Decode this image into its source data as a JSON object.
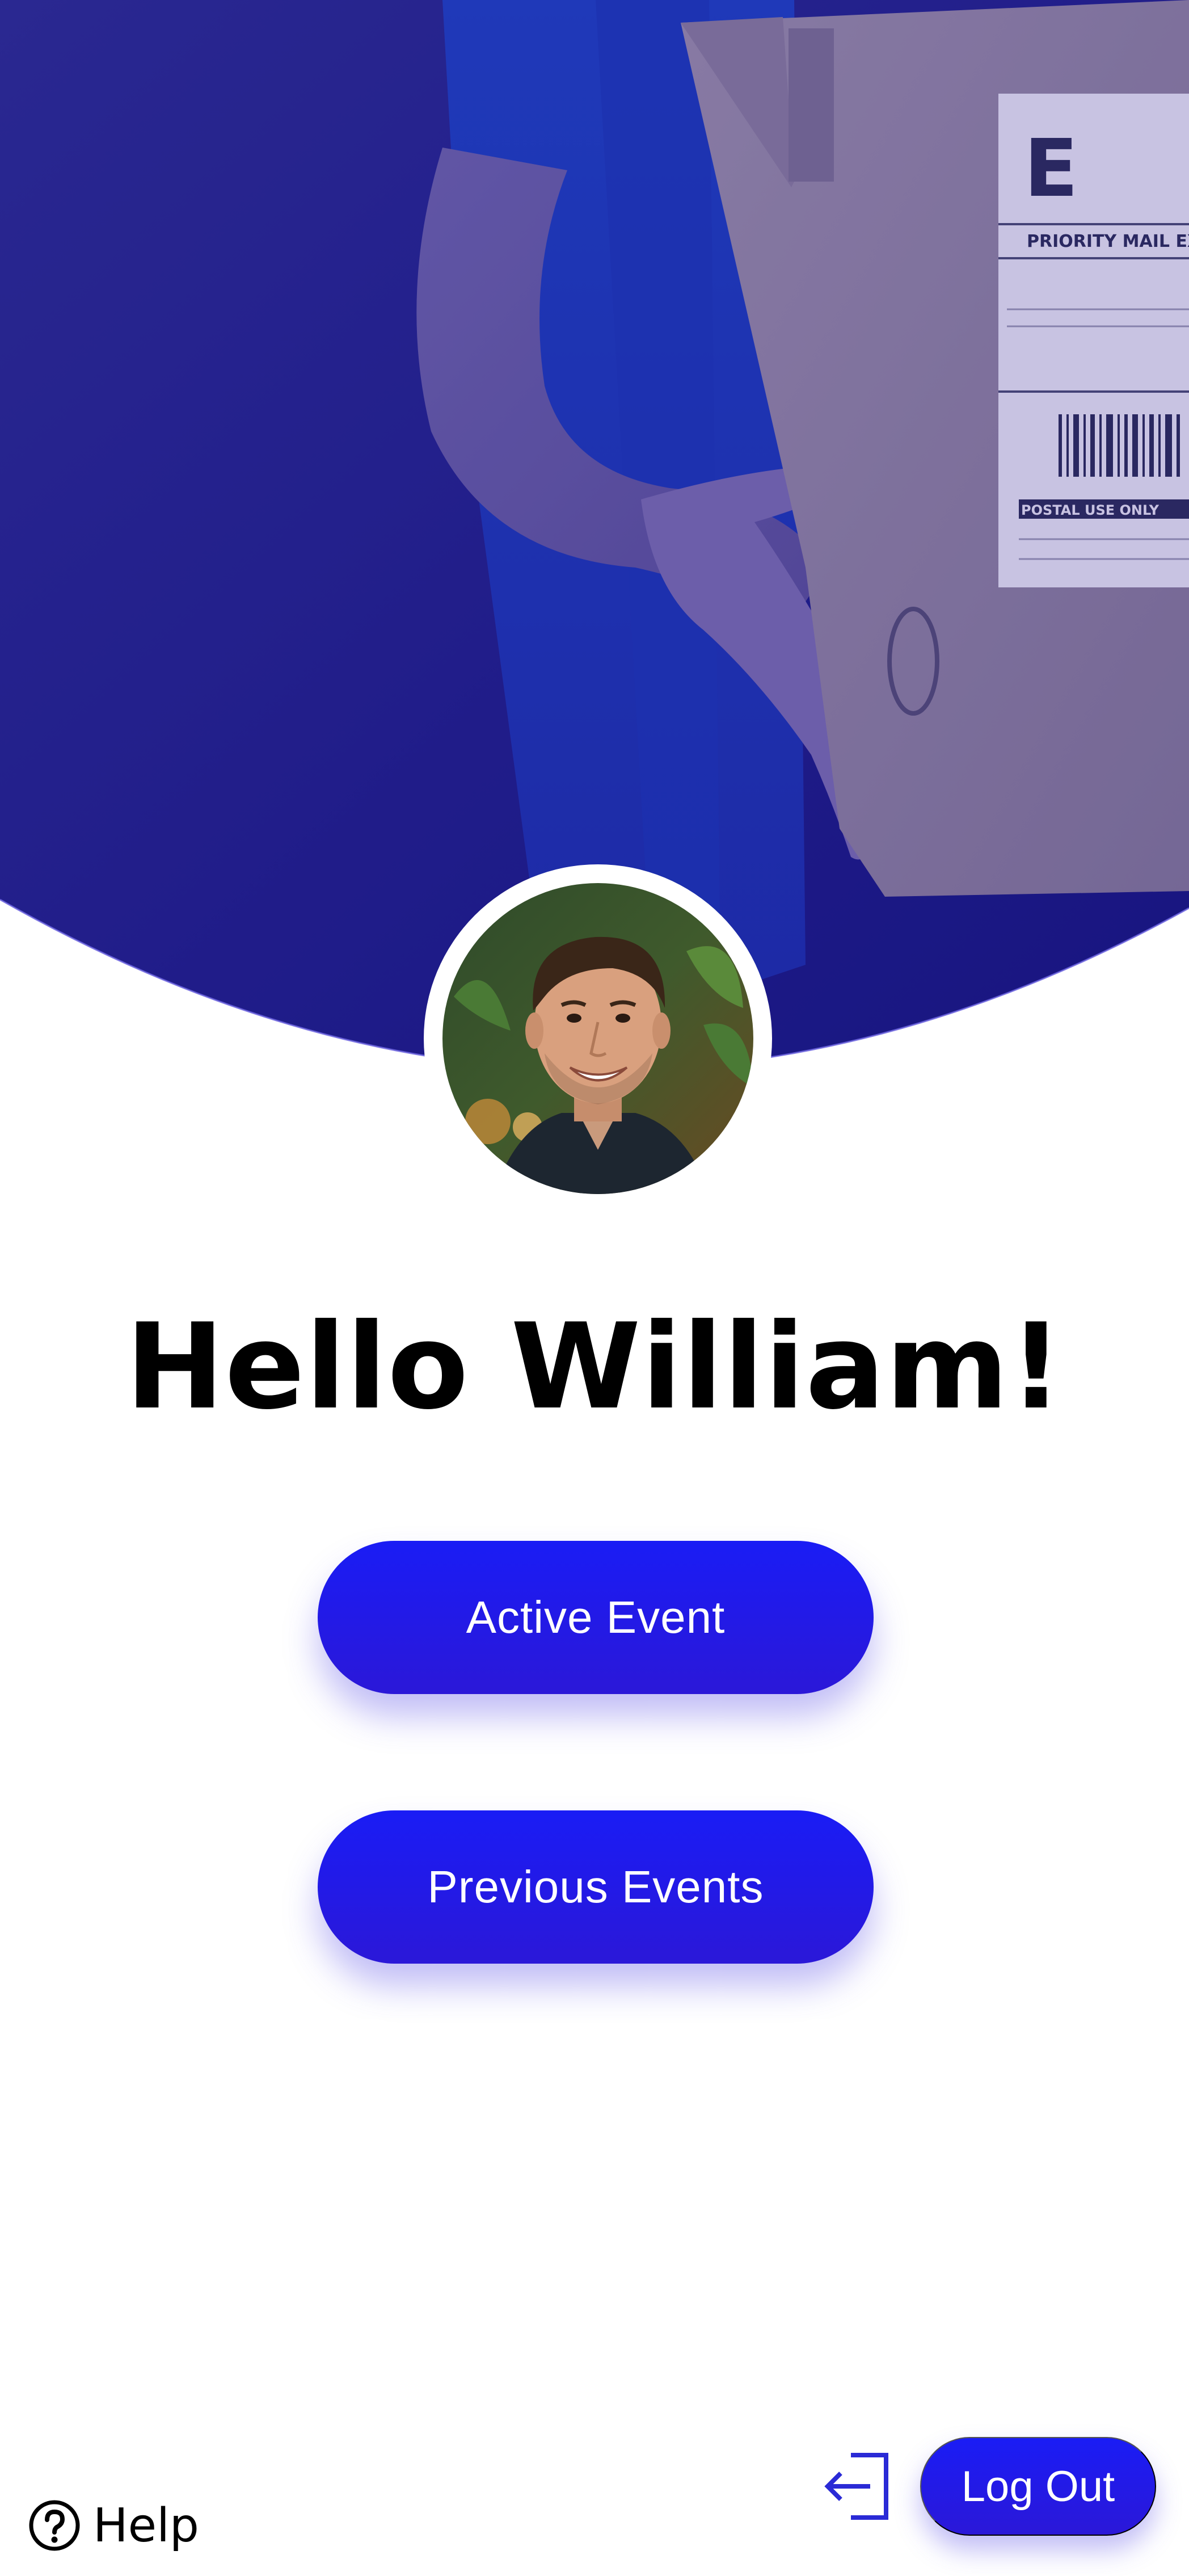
{
  "greeting": "Hello William!",
  "buttons": {
    "active_event": "Active Event",
    "previous_events": "Previous Events",
    "log_out": "Log Out"
  },
  "footer": {
    "help_label": "Help",
    "help_icon": "question-circle-icon",
    "logout_icon": "sign-out-icon"
  },
  "hero": {
    "photo": "delivery person holding cardboard package",
    "label_text": {
      "letter": "E",
      "service": "PRIORITY MAIL EXPR",
      "postal_use": "POSTAL USE ONLY"
    }
  },
  "avatar": {
    "description": "smiling man profile photo"
  },
  "colors": {
    "primary": "#1a1cf5",
    "primary_dark": "#2b18d8",
    "hero_overlay": "#1d1a7a",
    "text": "#000000",
    "background": "#ffffff"
  }
}
